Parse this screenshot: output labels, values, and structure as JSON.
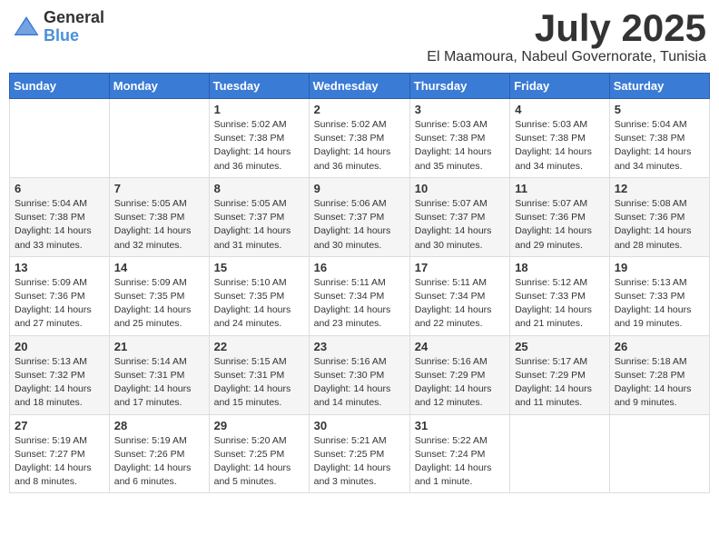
{
  "logo": {
    "general": "General",
    "blue": "Blue"
  },
  "title": "July 2025",
  "subtitle": "El Maamoura, Nabeul Governorate, Tunisia",
  "weekdays": [
    "Sunday",
    "Monday",
    "Tuesday",
    "Wednesday",
    "Thursday",
    "Friday",
    "Saturday"
  ],
  "weeks": [
    [
      null,
      null,
      {
        "day": 1,
        "sunrise": "5:02 AM",
        "sunset": "7:38 PM",
        "daylight": "14 hours and 36 minutes."
      },
      {
        "day": 2,
        "sunrise": "5:02 AM",
        "sunset": "7:38 PM",
        "daylight": "14 hours and 36 minutes."
      },
      {
        "day": 3,
        "sunrise": "5:03 AM",
        "sunset": "7:38 PM",
        "daylight": "14 hours and 35 minutes."
      },
      {
        "day": 4,
        "sunrise": "5:03 AM",
        "sunset": "7:38 PM",
        "daylight": "14 hours and 34 minutes."
      },
      {
        "day": 5,
        "sunrise": "5:04 AM",
        "sunset": "7:38 PM",
        "daylight": "14 hours and 34 minutes."
      }
    ],
    [
      {
        "day": 6,
        "sunrise": "5:04 AM",
        "sunset": "7:38 PM",
        "daylight": "14 hours and 33 minutes."
      },
      {
        "day": 7,
        "sunrise": "5:05 AM",
        "sunset": "7:38 PM",
        "daylight": "14 hours and 32 minutes."
      },
      {
        "day": 8,
        "sunrise": "5:05 AM",
        "sunset": "7:37 PM",
        "daylight": "14 hours and 31 minutes."
      },
      {
        "day": 9,
        "sunrise": "5:06 AM",
        "sunset": "7:37 PM",
        "daylight": "14 hours and 30 minutes."
      },
      {
        "day": 10,
        "sunrise": "5:07 AM",
        "sunset": "7:37 PM",
        "daylight": "14 hours and 30 minutes."
      },
      {
        "day": 11,
        "sunrise": "5:07 AM",
        "sunset": "7:36 PM",
        "daylight": "14 hours and 29 minutes."
      },
      {
        "day": 12,
        "sunrise": "5:08 AM",
        "sunset": "7:36 PM",
        "daylight": "14 hours and 28 minutes."
      }
    ],
    [
      {
        "day": 13,
        "sunrise": "5:09 AM",
        "sunset": "7:36 PM",
        "daylight": "14 hours and 27 minutes."
      },
      {
        "day": 14,
        "sunrise": "5:09 AM",
        "sunset": "7:35 PM",
        "daylight": "14 hours and 25 minutes."
      },
      {
        "day": 15,
        "sunrise": "5:10 AM",
        "sunset": "7:35 PM",
        "daylight": "14 hours and 24 minutes."
      },
      {
        "day": 16,
        "sunrise": "5:11 AM",
        "sunset": "7:34 PM",
        "daylight": "14 hours and 23 minutes."
      },
      {
        "day": 17,
        "sunrise": "5:11 AM",
        "sunset": "7:34 PM",
        "daylight": "14 hours and 22 minutes."
      },
      {
        "day": 18,
        "sunrise": "5:12 AM",
        "sunset": "7:33 PM",
        "daylight": "14 hours and 21 minutes."
      },
      {
        "day": 19,
        "sunrise": "5:13 AM",
        "sunset": "7:33 PM",
        "daylight": "14 hours and 19 minutes."
      }
    ],
    [
      {
        "day": 20,
        "sunrise": "5:13 AM",
        "sunset": "7:32 PM",
        "daylight": "14 hours and 18 minutes."
      },
      {
        "day": 21,
        "sunrise": "5:14 AM",
        "sunset": "7:31 PM",
        "daylight": "14 hours and 17 minutes."
      },
      {
        "day": 22,
        "sunrise": "5:15 AM",
        "sunset": "7:31 PM",
        "daylight": "14 hours and 15 minutes."
      },
      {
        "day": 23,
        "sunrise": "5:16 AM",
        "sunset": "7:30 PM",
        "daylight": "14 hours and 14 minutes."
      },
      {
        "day": 24,
        "sunrise": "5:16 AM",
        "sunset": "7:29 PM",
        "daylight": "14 hours and 12 minutes."
      },
      {
        "day": 25,
        "sunrise": "5:17 AM",
        "sunset": "7:29 PM",
        "daylight": "14 hours and 11 minutes."
      },
      {
        "day": 26,
        "sunrise": "5:18 AM",
        "sunset": "7:28 PM",
        "daylight": "14 hours and 9 minutes."
      }
    ],
    [
      {
        "day": 27,
        "sunrise": "5:19 AM",
        "sunset": "7:27 PM",
        "daylight": "14 hours and 8 minutes."
      },
      {
        "day": 28,
        "sunrise": "5:19 AM",
        "sunset": "7:26 PM",
        "daylight": "14 hours and 6 minutes."
      },
      {
        "day": 29,
        "sunrise": "5:20 AM",
        "sunset": "7:25 PM",
        "daylight": "14 hours and 5 minutes."
      },
      {
        "day": 30,
        "sunrise": "5:21 AM",
        "sunset": "7:25 PM",
        "daylight": "14 hours and 3 minutes."
      },
      {
        "day": 31,
        "sunrise": "5:22 AM",
        "sunset": "7:24 PM",
        "daylight": "14 hours and 1 minute."
      },
      null,
      null
    ]
  ]
}
